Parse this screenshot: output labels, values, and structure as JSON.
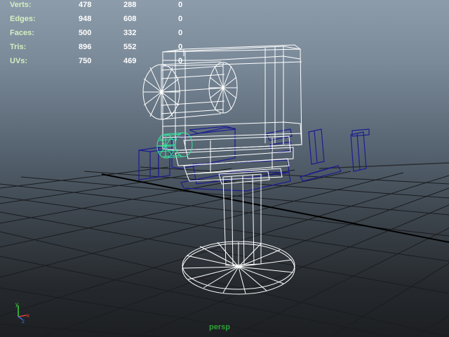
{
  "hud": {
    "rows": [
      {
        "label": "Verts:",
        "v1": "478",
        "v2": "288",
        "v3": "0"
      },
      {
        "label": "Edges:",
        "v1": "948",
        "v2": "608",
        "v3": "0"
      },
      {
        "label": "Faces:",
        "v1": "500",
        "v2": "332",
        "v3": "0"
      },
      {
        "label": "Tris:",
        "v1": "896",
        "v2": "552",
        "v3": "0"
      },
      {
        "label": "UVs:",
        "v1": "750",
        "v2": "469",
        "v3": "0"
      }
    ]
  },
  "viewport": {
    "camera": "persp",
    "colors": {
      "background_top": "#8d9cab",
      "background_bottom": "#1d1f22",
      "grid": "#1a1c1f",
      "wireframe_selected": "#ffffff",
      "wireframe_unselected": "#1a1a8a",
      "wireframe_highlight": "#35e8a0",
      "hud_label": "#d6efc0",
      "camera_label": "#2f9f36"
    }
  },
  "gizmo": {
    "x": "x",
    "y": "y",
    "z": "z"
  }
}
